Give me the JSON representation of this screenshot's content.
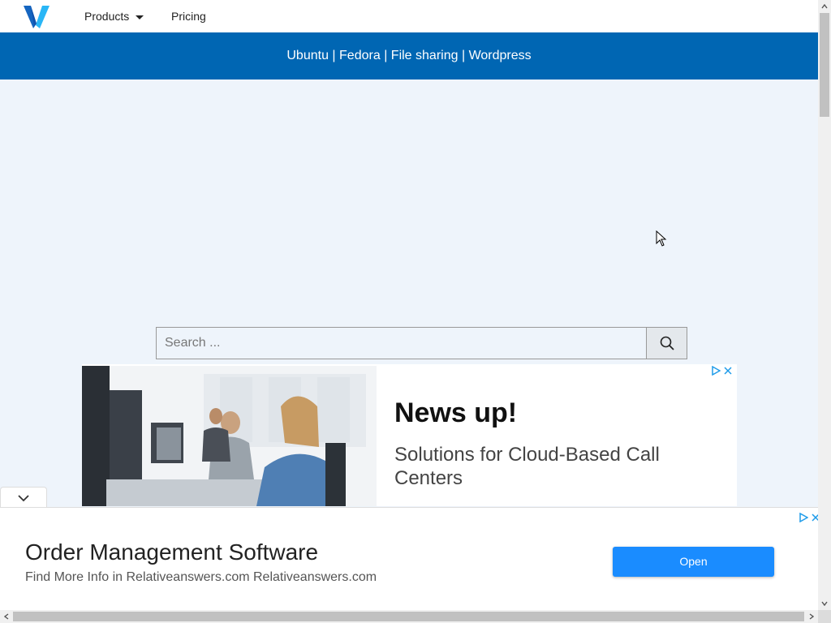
{
  "nav": {
    "products_label": "Products",
    "pricing_label": "Pricing"
  },
  "banner": {
    "links": [
      "Ubuntu",
      "Fedora",
      "File sharing",
      "Wordpress"
    ],
    "separator": "|"
  },
  "search": {
    "placeholder": "Search ...",
    "value": ""
  },
  "ad_top": {
    "title": "News up!",
    "subtitle": "Solutions for Cloud-Based Call Centers"
  },
  "ad_bottom": {
    "title": "Order Management Software",
    "subtitle": "Find More Info in Relativeanswers.com Relativeanswers.com",
    "button_label": "Open"
  },
  "colors": {
    "banner_bg": "#0066b3",
    "page_bg": "#eef4fb",
    "open_button": "#1a8cff",
    "logo_blue": "#1565c0",
    "logo_cyan": "#29b6f6"
  },
  "icons": {
    "logo": "v-logo-icon",
    "search": "search-icon",
    "collapse": "chevron-down-icon",
    "adchoices": "adchoices-icon",
    "close": "close-icon"
  }
}
